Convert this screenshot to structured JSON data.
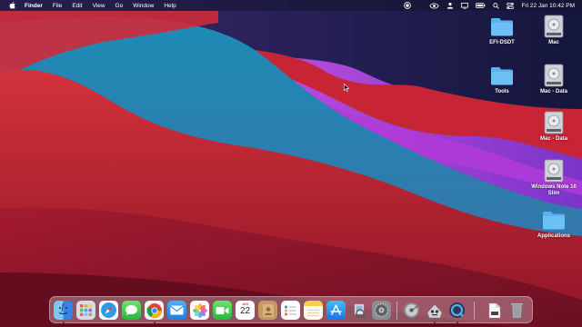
{
  "menubar": {
    "app_name": "Finder",
    "menus": [
      "File",
      "Edit",
      "View",
      "Go",
      "Window",
      "Help"
    ],
    "clock": "Fri 22 Jan  10:42 PM"
  },
  "desktop": {
    "icons": [
      {
        "label": "EFI-DSDT",
        "type": "folder"
      },
      {
        "label": "Mac",
        "type": "drive"
      },
      {
        "label": "Tools",
        "type": "folder"
      },
      {
        "label": "Mac - Data",
        "type": "drive"
      },
      {
        "label": "Mac - Data",
        "type": "drive"
      },
      {
        "label": "Windows Note 10 Slim",
        "type": "drive"
      },
      {
        "label": "Applications",
        "type": "folder"
      }
    ]
  },
  "dock": {
    "apps": [
      "finder-icon",
      "launchpad-icon",
      "safari-icon",
      "messages-icon",
      "chrome-icon",
      "mail-icon",
      "photos-icon",
      "facetime-icon",
      "calendar-icon",
      "contacts-icon",
      "reminders-icon",
      "notes-icon",
      "app-store-icon",
      "preview-icon",
      "system-preferences-icon",
      "disk-utility-icon",
      "automator-icon",
      "quicktime-icon",
      "document-icon",
      "trash-icon"
    ],
    "calendar": {
      "month": "JAN",
      "day": "22"
    }
  },
  "colors": {
    "folder_blue": "#5ab3f0",
    "wallpaper_red": "#c2222e",
    "wallpaper_blue": "#2a8fb4",
    "wallpaper_purple": "#a43bd6"
  }
}
